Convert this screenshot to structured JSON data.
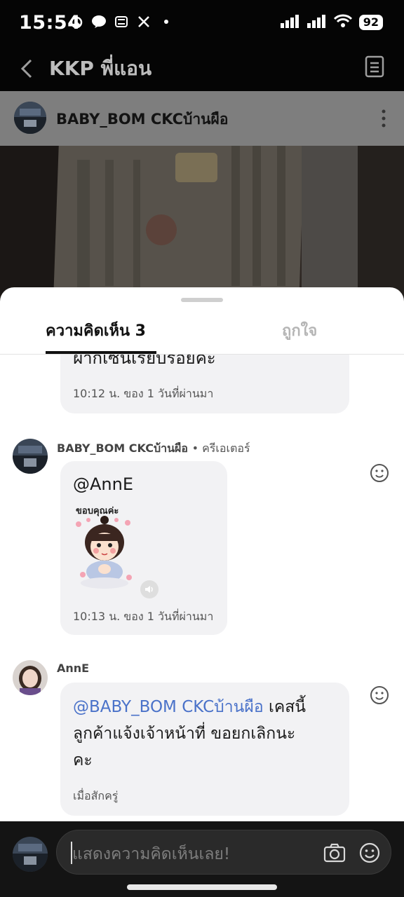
{
  "status_bar": {
    "time": "15:54",
    "battery": "92"
  },
  "header": {
    "title": "KKP พี่แอน"
  },
  "post": {
    "author": "BABY_BOM CKCบ้านผือ"
  },
  "sheet": {
    "tabs": {
      "comments": "ความคิดเห็น 3",
      "likes": "ถูกใจ"
    }
  },
  "comments": [
    {
      "text": "ฝากเซ็นเรียบร้อยค่ะ",
      "time": "10:12 น. ของ 1 วันที่ผ่านมา"
    },
    {
      "author": "BABY_BOM CKCบ้านผือ",
      "role": "• ครีเอเตอร์",
      "mention": "@AnnE",
      "sticker_text": "ขอบคุณค่ะ",
      "time": "10:13 น. ของ 1 วันที่ผ่านมา"
    },
    {
      "author": "AnnE",
      "mention": "@BABY_BOM CKCบ้านผือ",
      "text_line1": " เคสนี้",
      "text_line2": "ลูกค้าแจ้งเจ้าหน้าที่ ขอยกเลิกนะ",
      "text_line3": "คะ",
      "time": "เมื่อสักครู่"
    }
  ],
  "input": {
    "placeholder": "แสดงความคิดเห็นเลย!"
  },
  "colors": {
    "mention": "#4a72c9",
    "bubble": "#f2f2f4",
    "bar": "#141414"
  }
}
